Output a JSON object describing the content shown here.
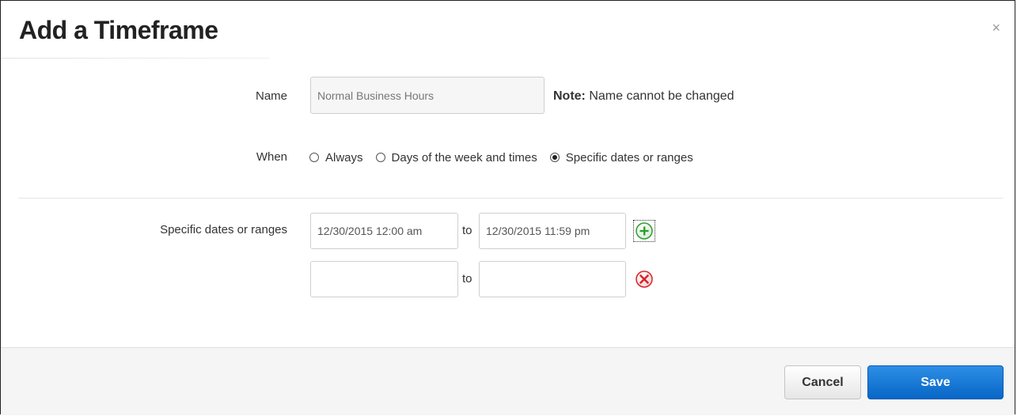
{
  "dialog": {
    "title": "Add a Timeframe",
    "close_label": "×"
  },
  "form": {
    "name": {
      "label": "Name",
      "value": "Normal Business Hours",
      "note_bold": "Note:",
      "note_text": " Name cannot be changed"
    },
    "when": {
      "label": "When",
      "options": [
        {
          "label": "Always",
          "checked": false
        },
        {
          "label": "Days of the week and times",
          "checked": false
        },
        {
          "label": "Specific dates or ranges",
          "checked": true
        }
      ]
    },
    "ranges": {
      "label": "Specific dates or ranges",
      "to_label": "to",
      "rows": [
        {
          "start": "12/30/2015 12:00 am",
          "end": "12/30/2015 11:59 pm",
          "action_icon": "add-circle-icon"
        },
        {
          "start": "",
          "end": "",
          "action_icon": "remove-circle-icon"
        }
      ]
    }
  },
  "footer": {
    "cancel_label": "Cancel",
    "save_label": "Save"
  },
  "colors": {
    "primary": "#1a7ad9",
    "add_green": "#2e9e2e",
    "remove_red": "#d8232a"
  }
}
